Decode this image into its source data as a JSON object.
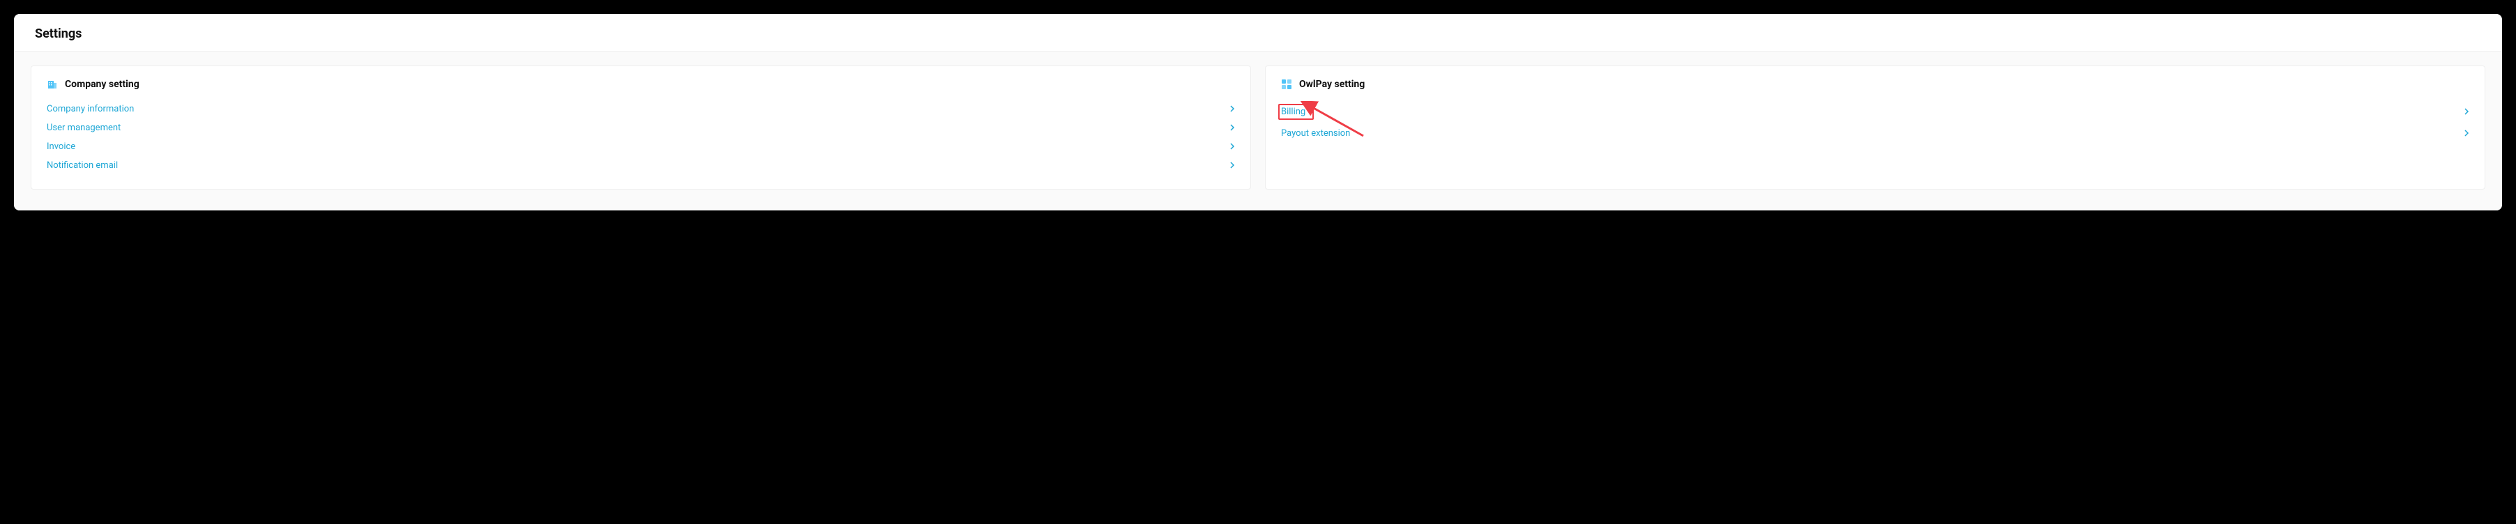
{
  "page": {
    "title": "Settings"
  },
  "companyCard": {
    "title": "Company setting",
    "items": [
      {
        "label": "Company information"
      },
      {
        "label": "User management"
      },
      {
        "label": "Invoice"
      },
      {
        "label": "Notification email"
      }
    ]
  },
  "owlpayCard": {
    "title": "OwlPay setting",
    "items": [
      {
        "label": "Billing",
        "highlighted": true
      },
      {
        "label": "Payout extension"
      }
    ]
  },
  "colors": {
    "link": "#1ea7d6",
    "annotation": "#ef3d46"
  }
}
